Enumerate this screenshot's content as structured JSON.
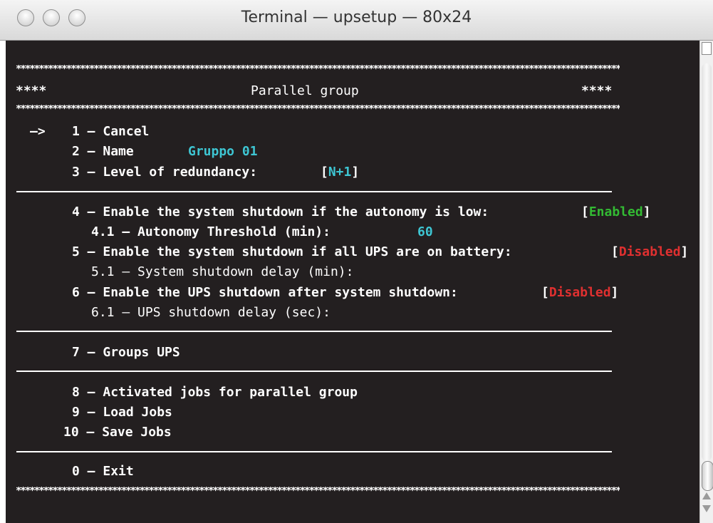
{
  "window": {
    "title": "Terminal — upsetup — 80x24"
  },
  "terminal": {
    "border": "****",
    "header": "Parallel group",
    "cursor": "—>",
    "menu": {
      "item1": {
        "num": "1",
        "label": "Cancel"
      },
      "item2": {
        "num": "2",
        "label": "Name",
        "value": "Gruppo 01"
      },
      "item3": {
        "num": "3",
        "label": "Level of redundancy:",
        "value": "N+1"
      },
      "item4": {
        "num": "4",
        "label": "Enable the system shutdown if the autonomy is low:",
        "value": "Enabled"
      },
      "item4_1": {
        "num": "4.1",
        "label": "Autonomy Threshold (min):",
        "value": "60"
      },
      "item5": {
        "num": "5",
        "label": "Enable the system shutdown if all UPS are on battery:",
        "value": "Disabled"
      },
      "item5_1": {
        "num": "5.1",
        "label": "System shutdown delay (min):"
      },
      "item6": {
        "num": "6",
        "label": "Enable the UPS shutdown after system shutdown:",
        "value": "Disabled"
      },
      "item6_1": {
        "num": "6.1",
        "label": "UPS shutdown delay (sec):"
      },
      "item7": {
        "num": "7",
        "label": "Groups UPS"
      },
      "item8": {
        "num": "8",
        "label": "Activated jobs for parallel group"
      },
      "item9": {
        "num": "9",
        "label": "Load Jobs"
      },
      "item10": {
        "num": "10",
        "label": "Save Jobs"
      },
      "item0": {
        "num": "0",
        "label": "Exit"
      }
    }
  },
  "colors": {
    "background": "#231f20",
    "text": "#ffffff",
    "value": "#3ec6d3",
    "enabled": "#33bb33",
    "disabled": "#e03030"
  },
  "icons": [
    "close-window-icon",
    "minimize-window-icon",
    "zoom-window-icon",
    "scroll-up-arrow-icon",
    "scroll-down-arrow-icon"
  ]
}
